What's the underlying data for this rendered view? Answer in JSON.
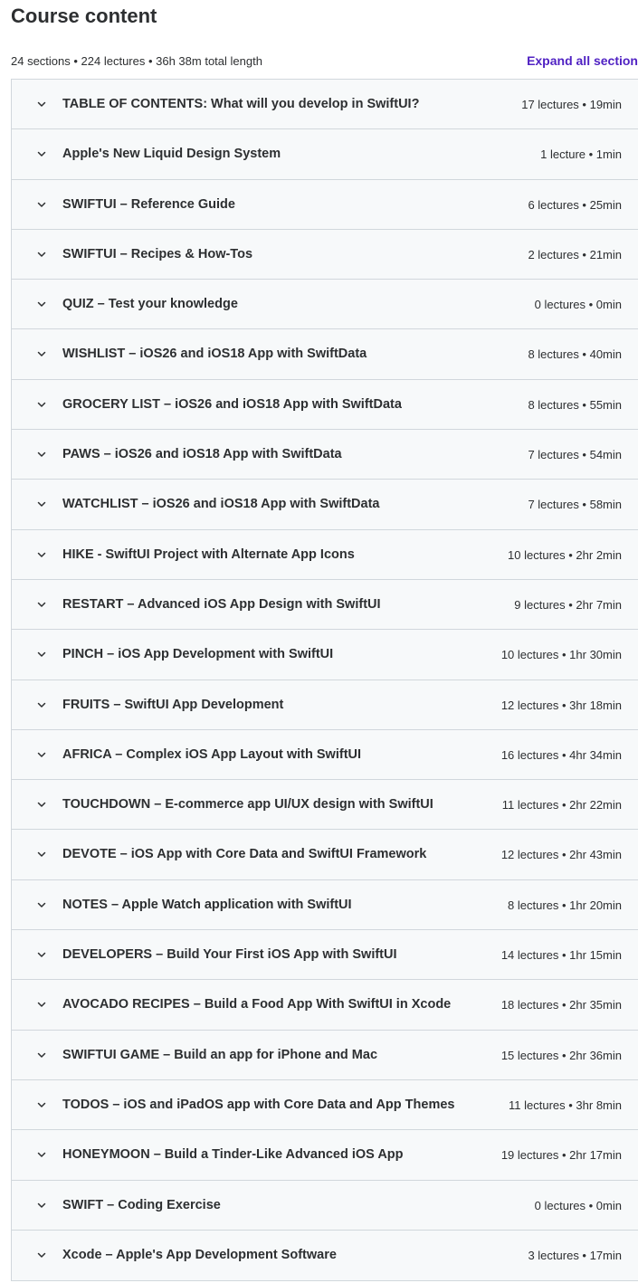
{
  "header": {
    "title": "Course content",
    "stats": "24 sections • 224 lectures • 36h 38m total length",
    "expand_all_label": "Expand all section"
  },
  "colors": {
    "accent": "#5022c3",
    "row_background": "#f7f9fa",
    "border": "#d1d7dc",
    "text": "#2d2f31"
  },
  "sections": [
    {
      "title": "TABLE OF CONTENTS: What will you develop in SwiftUI?",
      "meta": "17 lectures • 19min"
    },
    {
      "title": "Apple's New Liquid Design System",
      "meta": "1 lecture • 1min"
    },
    {
      "title": "SWIFTUI – Reference Guide",
      "meta": "6 lectures • 25min"
    },
    {
      "title": "SWIFTUI – Recipes & How-Tos",
      "meta": "2 lectures • 21min"
    },
    {
      "title": "QUIZ – Test your knowledge",
      "meta": "0 lectures • 0min"
    },
    {
      "title": "WISHLIST – iOS26 and iOS18 App with SwiftData",
      "meta": "8 lectures • 40min"
    },
    {
      "title": "GROCERY LIST – iOS26 and iOS18 App with SwiftData",
      "meta": "8 lectures • 55min"
    },
    {
      "title": "PAWS – iOS26 and iOS18 App with SwiftData",
      "meta": "7 lectures • 54min"
    },
    {
      "title": "WATCHLIST – iOS26 and iOS18 App with SwiftData",
      "meta": "7 lectures • 58min"
    },
    {
      "title": "HIKE - SwiftUI Project with Alternate App Icons",
      "meta": "10 lectures • 2hr 2min"
    },
    {
      "title": "RESTART – Advanced iOS App Design with SwiftUI",
      "meta": "9 lectures • 2hr 7min"
    },
    {
      "title": "PINCH – iOS App Development with SwiftUI",
      "meta": "10 lectures • 1hr 30min"
    },
    {
      "title": "FRUITS – SwiftUI App Development",
      "meta": "12 lectures • 3hr 18min"
    },
    {
      "title": "AFRICA – Complex iOS App Layout with SwiftUI",
      "meta": "16 lectures • 4hr 34min"
    },
    {
      "title": "TOUCHDOWN – E-commerce app UI/UX design with SwiftUI",
      "meta": "11 lectures • 2hr 22min"
    },
    {
      "title": "DEVOTE – iOS App with Core Data and SwiftUI Framework",
      "meta": "12 lectures • 2hr 43min"
    },
    {
      "title": "NOTES – Apple Watch application with SwiftUI",
      "meta": "8 lectures • 1hr 20min"
    },
    {
      "title": "DEVELOPERS – Build Your First iOS App with SwiftUI",
      "meta": "14 lectures • 1hr 15min"
    },
    {
      "title": "AVOCADO RECIPES – Build a Food App With SwiftUI in Xcode",
      "meta": "18 lectures • 2hr 35min"
    },
    {
      "title": "SWIFTUI GAME – Build an app for iPhone and Mac",
      "meta": "15 lectures • 2hr 36min"
    },
    {
      "title": "TODOS – iOS and iPadOS app with Core Data and App Themes",
      "meta": "11 lectures • 3hr 8min"
    },
    {
      "title": "HONEYMOON – Build a Tinder-Like Advanced iOS App",
      "meta": "19 lectures • 2hr 17min"
    },
    {
      "title": "SWIFT – Coding Exercise",
      "meta": "0 lectures • 0min"
    },
    {
      "title": "Xcode – Apple's App Development Software",
      "meta": "3 lectures • 17min"
    }
  ]
}
